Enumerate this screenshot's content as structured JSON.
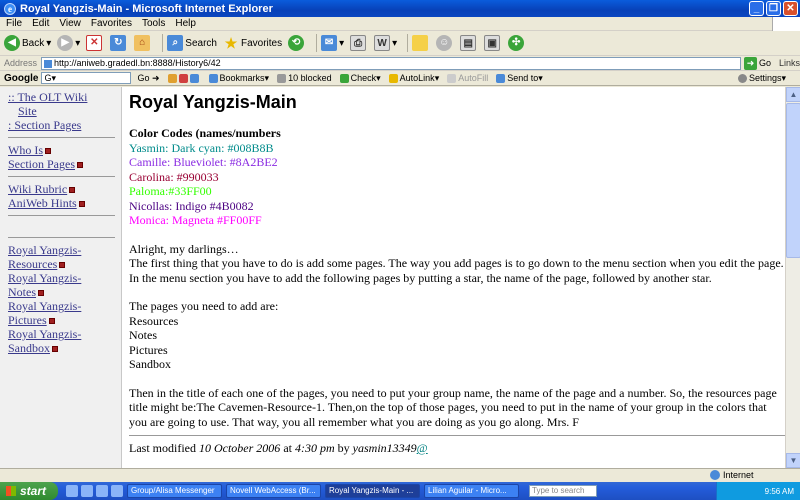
{
  "window": {
    "title": "Royal Yangzis-Main - Microsoft Internet Explorer"
  },
  "menu": [
    "File",
    "Edit",
    "View",
    "Favorites",
    "Tools",
    "Help"
  ],
  "toolbar": {
    "back_label": "Back",
    "search_label": "Search",
    "favorites_label": "Favorites"
  },
  "address": {
    "label": "Address",
    "url": "http://aniweb.gradedl.bn:8888/History6/42",
    "go_label": "Go",
    "links_label": "Links"
  },
  "googlebar": {
    "logo": "Google",
    "go_label": "Go",
    "bookmarks": "Bookmarks",
    "blocked": "10 blocked",
    "check": "Check",
    "autolink": "AutoLink",
    "autofill": "AutoFill",
    "sendto": "Send to",
    "settings": "Settings"
  },
  "sidebar": {
    "olt_wiki": ":: The OLT Wiki",
    "olt_wiki_2": "Site",
    "section_pages_top": ": Section Pages",
    "who_is": "Who Is",
    "section_pages": "Section Pages",
    "wiki_rubric": "Wiki Rubric",
    "aniweb_hints": "AniWeb Hints",
    "links": [
      {
        "line1": "Royal Yangzis-",
        "line2": "Resources"
      },
      {
        "line1": "Royal Yangzis-",
        "line2": "Notes"
      },
      {
        "line1": "Royal Yangzis-",
        "line2": "Pictures"
      },
      {
        "line1": "Royal Yangzis-",
        "line2": "Sandbox"
      }
    ]
  },
  "page": {
    "title": "Royal Yangzis-Main",
    "color_codes_title": "Color Codes (names/numbers",
    "color_codes": [
      {
        "text": "Yasmin: Dark cyan: #008B8B",
        "color": "#008B8B"
      },
      {
        "text": "Camille: Blueviolet: #8A2BE2",
        "color": "#8A2BE2"
      },
      {
        "text": "Carolina: #990033",
        "color": "#990033"
      },
      {
        "text": "Paloma:#33FF00",
        "color": "#33FF00"
      },
      {
        "text": "Nicollas: Indigo #4B0082",
        "color": "#4B0082"
      },
      {
        "text": "Monica: Magneta #FF00FF",
        "color": "#FF00FF"
      }
    ],
    "greeting": "Alright, my darlings…",
    "intro": "The first thing that you have to do is add some pages. The way you add pages is to go down to the menu section when you edit the page. In the menu section you have to add the following pages by putting a star, the name of the page, followed by another star.",
    "pages_intro": "The pages you need to add are:",
    "pages": [
      "Resources",
      "Notes",
      "Pictures",
      "Sandbox"
    ],
    "instructions": "Then in the title of each one of the pages, you need to put your group name, the name of the page and a number. So, the resources page title might be:The Cavemen-Resource-1. Then,on the top of those pages, you need to put in the name of your group in the colors that you are going to use. That way, you all remember what you are doing as you go along. Mrs. F",
    "footer_prefix": "Last modified ",
    "footer_date": "10 October 2006",
    "footer_at": " at ",
    "footer_time": "4:30 pm",
    "footer_by": " by ",
    "footer_user": "yasmin13349",
    "footer_link": "@"
  },
  "status": {
    "zone": "Internet"
  },
  "taskbar": {
    "start": "start",
    "tasks": [
      "Group/Alisa Messenger",
      "Novell WebAccess (Br...",
      "Royal Yangzis-Main - ...",
      "Lilian Aguilar - Micro..."
    ],
    "search_placeholder": "Type to search",
    "clock": "9:56 AM"
  }
}
